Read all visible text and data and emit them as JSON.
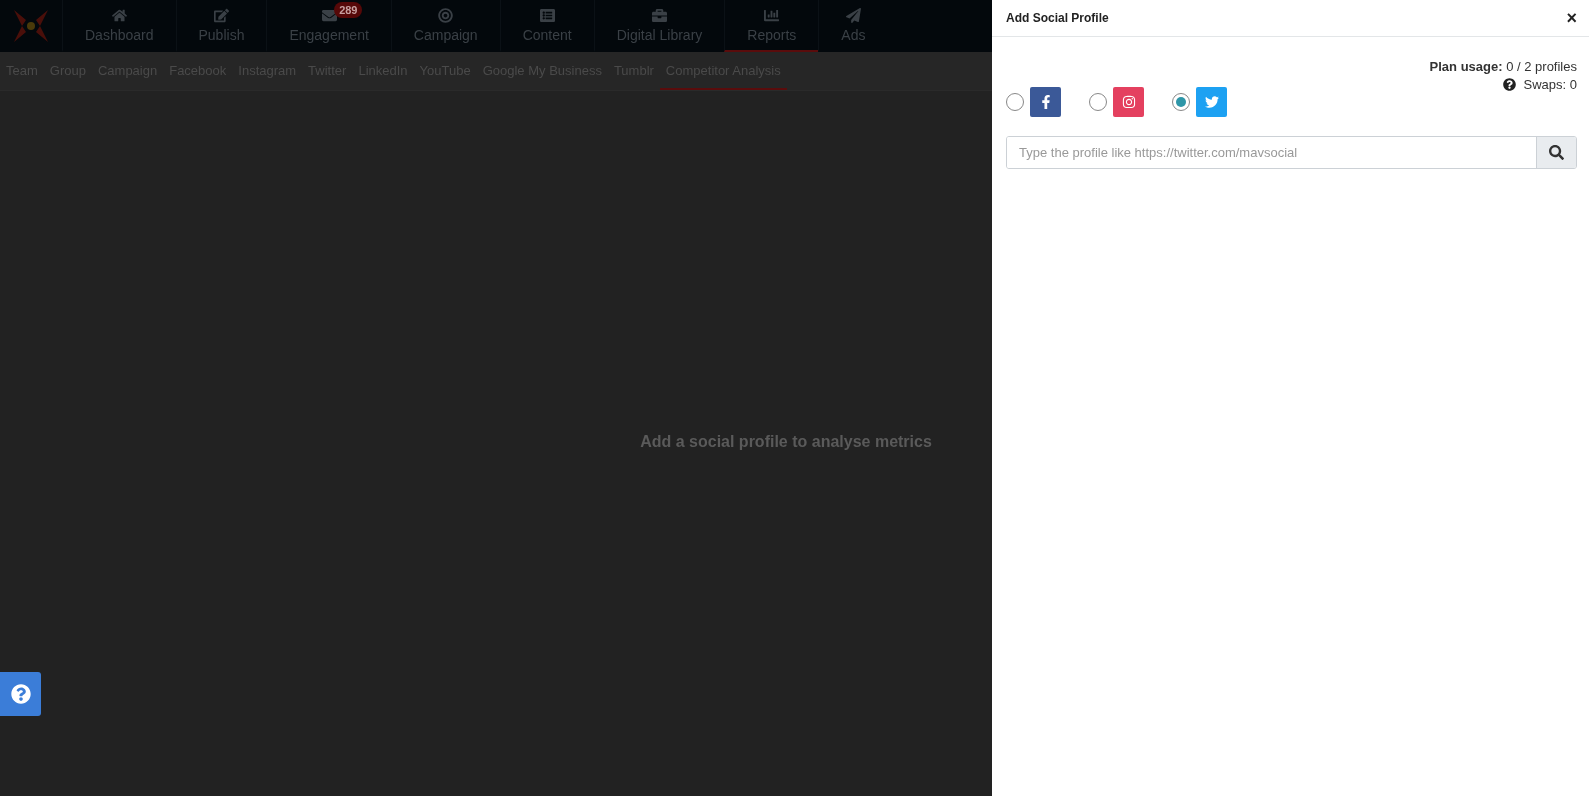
{
  "nav": {
    "items": [
      {
        "label": "Dashboard",
        "selected": false
      },
      {
        "label": "Publish",
        "selected": false
      },
      {
        "label": "Engagement",
        "selected": false,
        "badge": "289"
      },
      {
        "label": "Campaign",
        "selected": false
      },
      {
        "label": "Content",
        "selected": false
      },
      {
        "label": "Digital Library",
        "selected": false
      },
      {
        "label": "Reports",
        "selected": true
      },
      {
        "label": "Ads",
        "selected": false
      }
    ]
  },
  "subnav": {
    "items": [
      {
        "label": "Team",
        "selected": false
      },
      {
        "label": "Group",
        "selected": false
      },
      {
        "label": "Campaign",
        "selected": false
      },
      {
        "label": "Facebook",
        "selected": false
      },
      {
        "label": "Instagram",
        "selected": false
      },
      {
        "label": "Twitter",
        "selected": false
      },
      {
        "label": "LinkedIn",
        "selected": false
      },
      {
        "label": "YouTube",
        "selected": false
      },
      {
        "label": "Google My Business",
        "selected": false
      },
      {
        "label": "Tumblr",
        "selected": false
      },
      {
        "label": "Competitor Analysis",
        "selected": true
      }
    ]
  },
  "main": {
    "message": "Add a social profile to analyse metrics"
  },
  "panel": {
    "title": "Add Social Profile",
    "close": "×",
    "plan_usage_label": "Plan usage:",
    "plan_usage_value": "0 / 2 profiles",
    "swaps": "Swaps: 0",
    "networks": [
      {
        "kind": "facebook",
        "selected": false
      },
      {
        "kind": "instagram",
        "selected": false
      },
      {
        "kind": "twitter",
        "selected": true
      }
    ],
    "search": {
      "placeholder": "Type the profile like https://twitter.com/mavsocial"
    }
  }
}
